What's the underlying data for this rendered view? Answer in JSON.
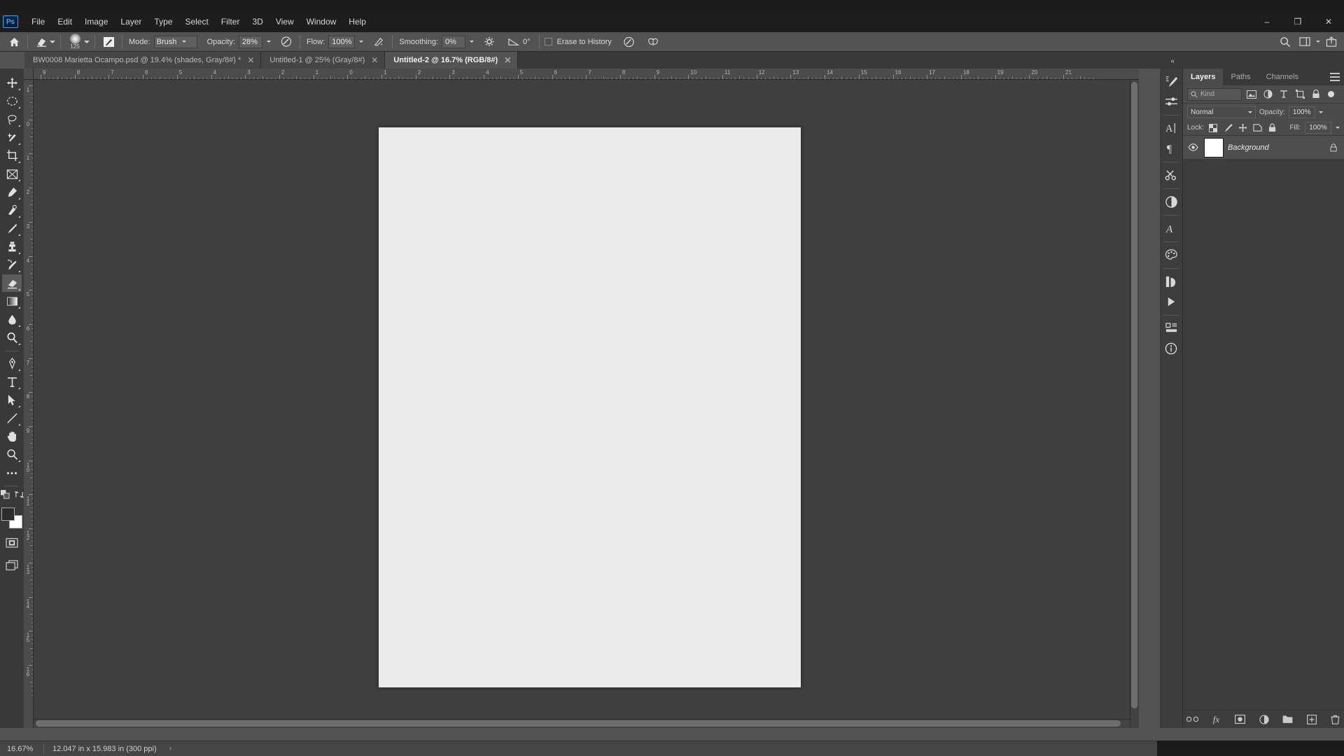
{
  "app": {
    "name": "Adobe Photoshop",
    "logo_text": "Ps"
  },
  "window_controls": {
    "minimize": "–",
    "restore": "❐",
    "close": "✕"
  },
  "menubar": {
    "items": [
      {
        "label": "File"
      },
      {
        "label": "Edit"
      },
      {
        "label": "Image"
      },
      {
        "label": "Layer"
      },
      {
        "label": "Type"
      },
      {
        "label": "Select"
      },
      {
        "label": "Filter"
      },
      {
        "label": "3D"
      },
      {
        "label": "View"
      },
      {
        "label": "Window"
      },
      {
        "label": "Help"
      }
    ]
  },
  "options_bar": {
    "home_icon": "home-icon",
    "tool_preset_icon": "eraser-tool-preset-icon",
    "brush_size": "125",
    "brush_settings_icon": "brush-settings-panel-icon",
    "mode_label": "Mode:",
    "mode_value": "Brush",
    "opacity_label": "Opacity:",
    "opacity_value": "28%",
    "pressure_opacity_icon": "pressure-for-opacity-icon",
    "flow_label": "Flow:",
    "flow_value": "100%",
    "airbrush_icon": "airbrush-icon",
    "smoothing_label": "Smoothing:",
    "smoothing_value": "0%",
    "smoothing_options_icon": "smoothing-options-gear-icon",
    "angle_icon": "brush-angle-icon",
    "angle_value": "0°",
    "erase_to_history_label": "Erase to History",
    "erase_to_history_checked": false,
    "tablet_pressure_size_icon": "tablet-pressure-size-icon",
    "symmetry_icon": "symmetry-butterfly-icon",
    "search_icon": "search-icon",
    "workspace_icon": "workspace-switcher-icon",
    "share_icon": "share-icon"
  },
  "document_tabs": [
    {
      "title": "BW0008 Marietta Ocampo.psd @ 19.4% (shades, Gray/8#) *",
      "active": false,
      "close": "✕"
    },
    {
      "title": "Untitled-1 @ 25% (Gray/8#)",
      "active": false,
      "close": "✕"
    },
    {
      "title": "Untitled-2 @ 16.7% (RGB/8#)",
      "active": true,
      "close": "✕"
    }
  ],
  "toolbar": {
    "tools": [
      {
        "name": "move-tool",
        "selected": false
      },
      {
        "name": "rectangular-marquee-tool",
        "selected": false
      },
      {
        "name": "lasso-tool",
        "selected": false
      },
      {
        "name": "object-selection-tool",
        "selected": false
      },
      {
        "name": "crop-tool",
        "selected": false
      },
      {
        "name": "frame-tool",
        "selected": false
      },
      {
        "name": "eyedropper-tool",
        "selected": false
      },
      {
        "name": "spot-healing-brush-tool",
        "selected": false
      },
      {
        "name": "brush-tool",
        "selected": false
      },
      {
        "name": "clone-stamp-tool",
        "selected": false
      },
      {
        "name": "history-brush-tool",
        "selected": false
      },
      {
        "name": "eraser-tool",
        "selected": true
      },
      {
        "name": "gradient-tool",
        "selected": false
      },
      {
        "name": "blur-tool",
        "selected": false
      },
      {
        "name": "dodge-tool",
        "selected": false
      },
      {
        "name": "pen-tool",
        "selected": false
      },
      {
        "name": "horizontal-type-tool",
        "selected": false
      },
      {
        "name": "path-selection-tool",
        "selected": false
      },
      {
        "name": "line-shape-tool",
        "selected": false
      },
      {
        "name": "hand-tool",
        "selected": false
      },
      {
        "name": "zoom-tool",
        "selected": false
      },
      {
        "name": "edit-toolbar-more-tools",
        "selected": false
      }
    ],
    "foreground_color": "#2c2c2c",
    "background_color": "#ffffff",
    "quick_mask_icon": "quick-mask-mode-icon",
    "screen_mode_icon": "screen-mode-icon"
  },
  "rulers": {
    "unit": "in",
    "horizontal_labels": [
      "9",
      "8",
      "7",
      "6",
      "5",
      "4",
      "3",
      "2",
      "1",
      "0",
      "1",
      "2",
      "3",
      "4",
      "5",
      "6",
      "7",
      "8",
      "9",
      "10",
      "11",
      "12",
      "13",
      "14",
      "15",
      "16",
      "17",
      "18",
      "19",
      "20",
      "21"
    ],
    "vertical_labels": [
      "1",
      "0",
      "1",
      "2",
      "3",
      "4",
      "5",
      "6",
      "7",
      "8",
      "9",
      "10",
      "11",
      "12",
      "13",
      "14",
      "15",
      "16"
    ]
  },
  "canvas": {
    "document_color": "#ebebeb",
    "background_color": "#3f3f3f"
  },
  "status_bar": {
    "zoom": "16.67%",
    "dimensions": "12.047 in x 15.983 in (300 ppi)",
    "expand_arrow": "›"
  },
  "right_dock": {
    "collapse_icon": "«",
    "icons": [
      {
        "name": "brush-settings-icon"
      },
      {
        "name": "brush-presets-icon"
      },
      {
        "name": "character-panel-icon"
      },
      {
        "name": "paragraph-panel-icon"
      },
      {
        "name": "tool-presets-icon"
      },
      {
        "name": "adjustments-panel-icon"
      },
      {
        "name": "glyphs-panel-icon"
      },
      {
        "name": "swatches-panel-icon"
      },
      {
        "name": "libraries-panel-icon"
      },
      {
        "name": "timeline-play-icon"
      },
      {
        "name": "properties-panel-icon"
      },
      {
        "name": "info-panel-icon"
      }
    ]
  },
  "layers_panel": {
    "tabs": [
      {
        "label": "Layers",
        "active": true
      },
      {
        "label": "Paths",
        "active": false
      },
      {
        "label": "Channels",
        "active": false
      }
    ],
    "menu_icon": "panel-menu-icon",
    "filter": {
      "search_icon": "search-icon",
      "kind_label": "Kind",
      "filter_icons": [
        {
          "name": "filter-pixel-layers-icon"
        },
        {
          "name": "filter-adjustment-layers-icon"
        },
        {
          "name": "filter-type-layers-icon"
        },
        {
          "name": "filter-shape-layers-icon"
        },
        {
          "name": "filter-smart-object-icon"
        }
      ],
      "toggle_name": "filter-toggle-switch"
    },
    "blend_mode": "Normal",
    "opacity_label": "Opacity:",
    "opacity_value": "100%",
    "lock_label": "Lock:",
    "lock_icons": [
      {
        "name": "lock-transparent-pixels-icon"
      },
      {
        "name": "lock-image-pixels-icon"
      },
      {
        "name": "lock-position-icon"
      },
      {
        "name": "lock-artboard-nesting-icon"
      },
      {
        "name": "lock-all-icon"
      }
    ],
    "fill_label": "Fill:",
    "fill_value": "100%",
    "layers": [
      {
        "name": "Background",
        "visible": true,
        "locked": true,
        "thumbnail_color": "#ffffff"
      }
    ],
    "bottom_buttons": [
      {
        "name": "link-layers-button",
        "glyph": "∞"
      },
      {
        "name": "add-layer-style-button",
        "glyph": "fx"
      },
      {
        "name": "add-layer-mask-button",
        "glyph": "▣"
      },
      {
        "name": "new-fill-adjustment-layer-button",
        "glyph": "◑"
      },
      {
        "name": "new-group-button",
        "glyph": "▰"
      },
      {
        "name": "new-layer-button",
        "glyph": "⊞"
      },
      {
        "name": "delete-layer-button",
        "glyph": "⌧"
      }
    ]
  },
  "colors": {
    "accent": "#31a8ff",
    "panel_bg": "#3d3d3d",
    "app_bg": "#535353",
    "canvas_bg": "#3f3f3f",
    "titlebar_bg": "#1b1b1b"
  }
}
